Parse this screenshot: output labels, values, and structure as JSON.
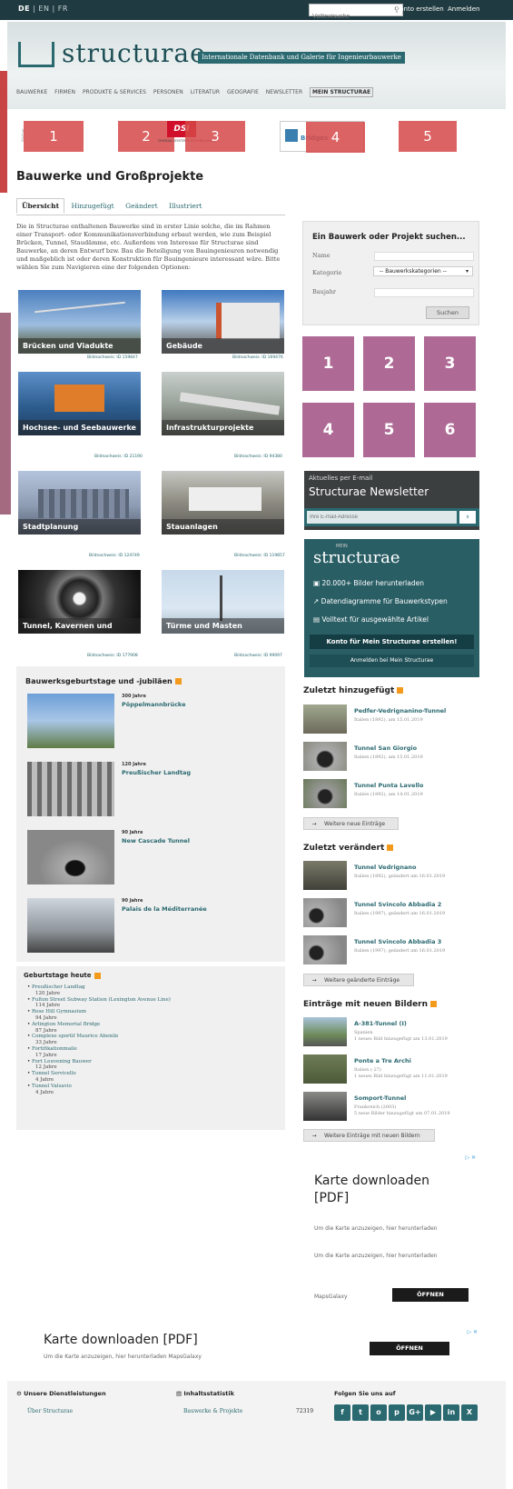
{
  "topbar": {
    "lang_de": "DE",
    "lang_sep1": "|",
    "lang_en": "EN",
    "lang_sep2": "|",
    "lang_fr": "FR",
    "search_placeholder": "Volltextsuche",
    "create_account": "Konto erstellen",
    "login": "Anmelden"
  },
  "brand": {
    "logo_text": "structurae",
    "tagline": "Internationale Datenbank und Galerie für Ingenieurbauwerke"
  },
  "nav": [
    "BAUWERKE",
    "FIRMEN",
    "PRODUKTE & SERVICES",
    "PERSONEN",
    "LITERATUR",
    "GEOGRAFIE",
    "NEWSLETTER",
    "MEIN STRUCTURAE"
  ],
  "partners": {
    "label": "Partner",
    "numbers": [
      "1",
      "2",
      "3",
      "4",
      "5"
    ],
    "dsi_logo": "DSI",
    "dsi_sub": "DYWIDAG-SYSTEMS INTERNATIONAL",
    "bridges_logo": "Bridges"
  },
  "page_title": "Bauwerke und Großprojekte",
  "tabs": [
    "Übersicht",
    "Hinzugefügt",
    "Geändert",
    "Illustriert"
  ],
  "intro": "Die in Structurae enthaltenen Bauwerke sind in erster Linie solche, die im Rahmen einer Transport- oder Kommunikationsverbindung erbaut werden, wie zum Beispiel Brücken, Tunnel, Staudämme, etc. Außerdem von Interesse für Structurae sind Bauwerke, an deren Entwurf bzw. Bau die Beteiligung von Bauingenieuren notwendig und maßgeblich ist oder deren Konstruktion für Bauingenieure interessant wäre. Bitte wählen Sie zum Navigieren eine der folgenden Optionen:",
  "categories": [
    {
      "label": "Brücken und Viadukte",
      "caption": "Bildnachweis: ID 159847"
    },
    {
      "label": "Gebäude",
      "caption": "Bildnachweis: ID 169476"
    },
    {
      "label": "Hochsee- und Seebauwerke",
      "caption": "Bildnachweis: ID 21190"
    },
    {
      "label": "Infrastrukturprojekte",
      "caption": "Bildnachweis: ID 94380"
    },
    {
      "label": "Stadtplanung",
      "caption": "Bildnachweis: ID 124749"
    },
    {
      "label": "Stauanlagen",
      "caption": "Bildnachweis: ID 119857"
    },
    {
      "label": "Tunnel, Kavernen und Schächte",
      "caption": "Bildnachweis: ID 177908"
    },
    {
      "label": "Türme und Masten",
      "caption": "Bildnachweis: ID 99097"
    }
  ],
  "finder": {
    "title": "Ein Bauwerk oder Projekt suchen...",
    "name_label": "Name",
    "category_label": "Kategorie",
    "category_value": "-- Bauwerkskategorien --",
    "year_label": "Baujahr",
    "search_button": "Suchen"
  },
  "sponsors": [
    "1",
    "2",
    "3",
    "4",
    "5",
    "6"
  ],
  "newsletter": {
    "kicker": "Aktuelles per E-mail",
    "title": "Structurae Newsletter",
    "email_placeholder": "Ihre E-mail-Adresse",
    "go": "›"
  },
  "promo": {
    "mein": "MEIN",
    "logo": "structurae",
    "features": [
      "20.000+ Bilder herunterladen",
      "Datendiagramme für Bauwerkstypen",
      "Volltext für ausgewählte Artikel"
    ],
    "cta": "Konto für Mein Structurae erstellen!",
    "login": "Anmelden bei Mein Structurae"
  },
  "added": {
    "title": "Zuletzt hinzugefügt",
    "items": [
      {
        "name": "Pedfer-Vedrignanino-Tunnel",
        "sub": "Italien (1892), am 15.01.2019"
      },
      {
        "name": "Tunnel San Giorgio",
        "sub": "Italien (1892), am 15.01.2019"
      },
      {
        "name": "Tunnel Punta Lavello",
        "sub": "Italien (1892), am 14.01.2019"
      }
    ],
    "more": "Weitere neue Einträge"
  },
  "changed": {
    "title": "Zuletzt verändert",
    "items": [
      {
        "name": "Tunnel Vedrignano",
        "sub": "Italien (1892), geändert am 16.01.2019"
      },
      {
        "name": "Tunnel Svincolo Abbadia 2",
        "sub": "Italien (1997), geändert am 16.01.2019"
      },
      {
        "name": "Tunnel Svincolo Abbadia 3",
        "sub": "Italien (1997), geändert am 16.01.2019"
      }
    ],
    "more": "Weitere geänderte Einträge"
  },
  "new_images": {
    "title": "Einträge mit neuen Bildern",
    "items": [
      {
        "name": "A-381-Tunnel (I)",
        "sub1": "Spanien",
        "sub2": "1 neues Bild hinzugefügt am 13.01.2019"
      },
      {
        "name": "Ponte a Tre Archi",
        "sub1": "Italien (-27)",
        "sub2": "1 neues Bild hinzugefügt am 11.01.2019"
      },
      {
        "name": "Somport-Tunnel",
        "sub1": "Frankreich (2003)",
        "sub2": "5 neue Bilder hinzugefügt am 07.01.2019"
      }
    ],
    "more": "Weitere Einträge mit neuen Bildern"
  },
  "anniversaries": {
    "title": "Bauwerksgeburtstage und -jubiläen",
    "items": [
      {
        "years": "300 Jahre",
        "name": "Pöppelmannbrücke"
      },
      {
        "years": "120 Jahre",
        "name": "Preußischer Landtag"
      },
      {
        "years": "90 Jahre",
        "name": "New Cascade Tunnel"
      },
      {
        "years": "90 Jahre",
        "name": "Palais de la Méditerranée"
      }
    ]
  },
  "birthdays": {
    "title": "Geburtstage heute",
    "items": [
      {
        "name": "Preußischer Landtag",
        "years": "120 Jahre"
      },
      {
        "name": "Fulton Street Subway Station (Lexington Avenue Line)",
        "years": "114 Jahre"
      },
      {
        "name": "Rose Hill Gymnasium",
        "years": "94 Jahre"
      },
      {
        "name": "Arlington Memorial Bridge",
        "years": "87 Jahre"
      },
      {
        "name": "Complexe sportif Maurice Abenile",
        "years": "33 Jahre"
      },
      {
        "name": "Fortifikationmaile",
        "years": "17 Jahre"
      },
      {
        "name": "Fort Leuvening Bauwer",
        "years": "12 Jahre"
      },
      {
        "name": "Tunnel Servicello",
        "years": "4 Jahre"
      },
      {
        "name": "Tunnel Valsavio",
        "years": "4 Jahre"
      }
    ]
  },
  "ad_side": {
    "badge": "▷ ✕",
    "title": "Karte downloaden [PDF]",
    "line1": "Um die Karte anzuzeigen, hier herunterladen",
    "line2": "Um die Karte anzuzeigen, hier herunterladen",
    "brand": "MapsGalaxy",
    "open": "ÖFFNEN"
  },
  "ad_bottom": {
    "badge": "▷ ✕",
    "title": "Karte downloaden [PDF]",
    "line": "Um die Karte anzuzeigen, hier herunterladen MapsGalaxy",
    "open": "ÖFFNEN"
  },
  "footer": {
    "services": "Unsere Dienstleistungen",
    "services_link": "Über Structurae",
    "stats": "Inhaltsstatistik",
    "stats_row": "Bauwerke & Projekte",
    "stats_count": "72319",
    "follow": "Folgen Sie uns auf",
    "social": [
      "f",
      "t",
      "o",
      "p",
      "G+",
      "▶",
      "in",
      "X"
    ]
  }
}
